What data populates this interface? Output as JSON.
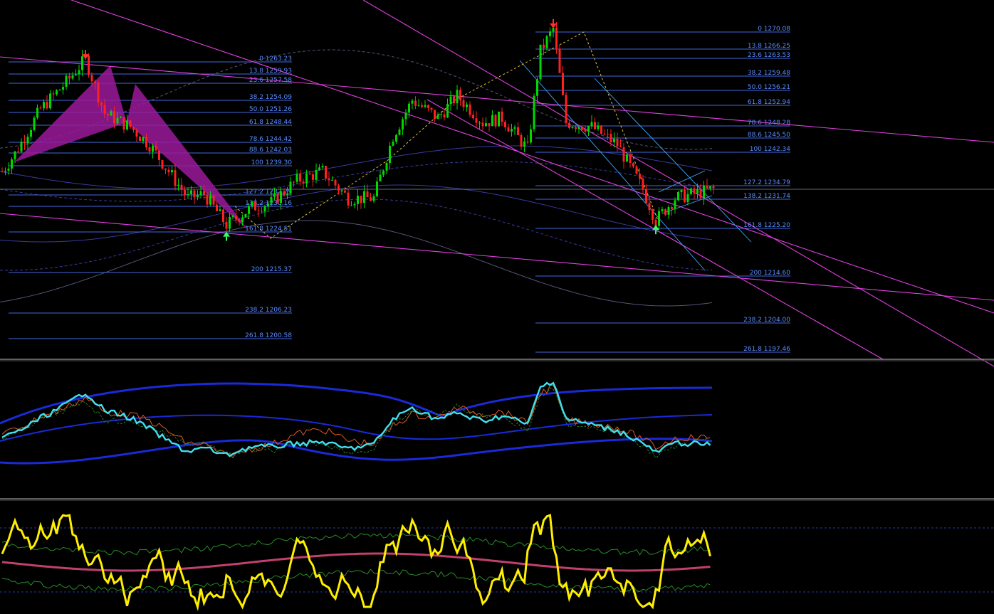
{
  "colors": {
    "background": "#000000",
    "fib_line": "#4169e1",
    "fib_text": "#5a8cff",
    "bull_candle": "#00d800",
    "bear_candle": "#ff2020",
    "trendline": "#e040e0",
    "pattern_fill": "#9a1a9a",
    "channel": "#40a8ff",
    "zigzag": "#e0c040",
    "envelope": "#3a3aa0",
    "envelope_dash": "#555577",
    "separator": "#c0c0c0",
    "osc_main": "#40e0f0",
    "osc_band": "#1a2ad8",
    "osc_fast": "#e05a20",
    "rsi_line": "#ffee00",
    "rsi_mid": "#c04070",
    "rsi_band": "#2a8a2a",
    "arrow_top": "#ff3030",
    "arrow_bottom": "#30ff60"
  },
  "fib_left": [
    {
      "label": "0 1263.23"
    },
    {
      "label": "13.8 1259.93"
    },
    {
      "label": "23.6 1257.58"
    },
    {
      "label": "38.2 1254.09"
    },
    {
      "label": "50.0 1251.26"
    },
    {
      "label": "61.8 1248.44"
    },
    {
      "label": "78.6 1244.42"
    },
    {
      "label": "88.6 1242.03"
    },
    {
      "label": "100 1239.30"
    },
    {
      "label": "127.2 1232.79"
    },
    {
      "label": "138.2 1230.16"
    },
    {
      "label": "161.8 1224.51"
    },
    {
      "label": "200 1215.37"
    },
    {
      "label": "238.2 1206.23"
    },
    {
      "label": "261.8 1200.58"
    }
  ],
  "fib_right": [
    {
      "label": "0 1270.08"
    },
    {
      "label": "13.8 1266.25"
    },
    {
      "label": "23.6 1263.53"
    },
    {
      "label": "38.2 1259.48"
    },
    {
      "label": "50.0 1256.21"
    },
    {
      "label": "61.8 1252.94"
    },
    {
      "label": "78.6 1248.28"
    },
    {
      "label": "88.6 1245.50"
    },
    {
      "label": "100 1242.34"
    },
    {
      "label": "127.2 1234.79"
    },
    {
      "label": "138.2 1231.74"
    },
    {
      "label": "161.8 1225.20"
    },
    {
      "label": "200 1214.60"
    },
    {
      "label": "238.2 1204.00"
    },
    {
      "label": "261.8 1197.46"
    }
  ],
  "chart_data": {
    "type": "candlestick",
    "title": "",
    "price_range": [
      1195,
      1275
    ],
    "price_path": [
      {
        "bar": 0,
        "price": 1238
      },
      {
        "bar": 4,
        "price": 1242
      },
      {
        "bar": 12,
        "price": 1252
      },
      {
        "bar": 20,
        "price": 1258
      },
      {
        "bar": 26,
        "price": 1263.2
      },
      {
        "bar": 32,
        "price": 1251
      },
      {
        "bar": 40,
        "price": 1248
      },
      {
        "bar": 46,
        "price": 1244
      },
      {
        "bar": 52,
        "price": 1238
      },
      {
        "bar": 58,
        "price": 1232
      },
      {
        "bar": 63,
        "price": 1233
      },
      {
        "bar": 70,
        "price": 1226
      },
      {
        "bar": 78,
        "price": 1230
      },
      {
        "bar": 84,
        "price": 1231
      },
      {
        "bar": 92,
        "price": 1236
      },
      {
        "bar": 100,
        "price": 1238
      },
      {
        "bar": 108,
        "price": 1232
      },
      {
        "bar": 116,
        "price": 1232
      },
      {
        "bar": 122,
        "price": 1246
      },
      {
        "bar": 128,
        "price": 1254
      },
      {
        "bar": 136,
        "price": 1250
      },
      {
        "bar": 142,
        "price": 1255
      },
      {
        "bar": 150,
        "price": 1249
      },
      {
        "bar": 156,
        "price": 1250
      },
      {
        "bar": 164,
        "price": 1243
      },
      {
        "bar": 168,
        "price": 1265
      },
      {
        "bar": 172,
        "price": 1270
      },
      {
        "bar": 176,
        "price": 1249
      },
      {
        "bar": 184,
        "price": 1248
      },
      {
        "bar": 192,
        "price": 1244
      },
      {
        "bar": 200,
        "price": 1234
      },
      {
        "bar": 204,
        "price": 1227
      },
      {
        "bar": 210,
        "price": 1232
      },
      {
        "bar": 216,
        "price": 1233
      },
      {
        "bar": 222,
        "price": 1234
      }
    ],
    "bar_count": 222,
    "markers": [
      {
        "type": "top",
        "bar": 26,
        "price": 1263.2
      },
      {
        "type": "bottom",
        "bar": 70,
        "price": 1224.5
      },
      {
        "type": "top",
        "bar": 172,
        "price": 1270.1
      },
      {
        "type": "bottom",
        "bar": 204,
        "price": 1226
      }
    ]
  }
}
